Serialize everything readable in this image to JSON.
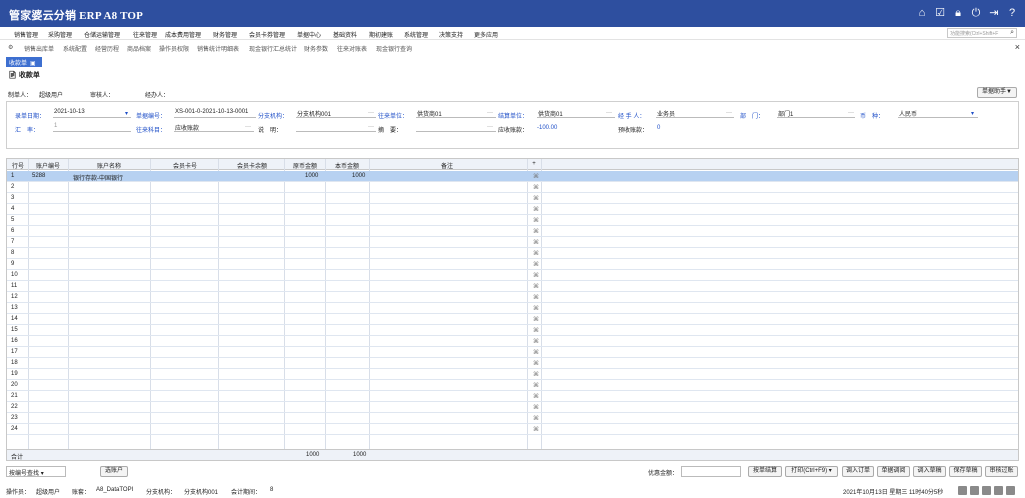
{
  "app": {
    "title": "管家婆云分销 ERP A8 TOP"
  },
  "menu": [
    "销售管理",
    "采购管理",
    "仓储运输管理",
    "往来管理",
    "成本费用管理",
    "财务管理",
    "会员卡券管理",
    "单据中心",
    "基础资料",
    "期初建账",
    "系统管理",
    "决策支持",
    "更多应用"
  ],
  "func_search": "功能搜索(Ctrl+Shift+F",
  "quick": [
    "销售出库单",
    "系统配置",
    "经营历程",
    "商品档案",
    "操作员权限",
    "销售统计明细表",
    "现金银行汇总统计",
    "财务参数",
    "往来对账表",
    "现金银行查询"
  ],
  "tab": "收款单",
  "doc": {
    "title": "收款单",
    "maker_label": "制单人：",
    "maker": "超级用户",
    "reviewer_label": "审核人：",
    "handler_label": "经办人：",
    "helper": "单据助手▼"
  },
  "fields": {
    "date_label": "录单日期：",
    "date": "2021-10-13",
    "no_label": "单据编号：",
    "no": "XS-001-0-2021-10-13-0001",
    "branch_label": "分支机构：",
    "branch": "分支机构001",
    "unit_label": "往来单位：",
    "unit": "供货商01",
    "settle_label": "结算单位：",
    "settle": "供货商01",
    "agent_label": "经 手 人：",
    "agent": "业务员",
    "dept_label": "部　门：",
    "dept": "部门1",
    "cur_label": "币　种：",
    "cur": "人民币",
    "rate_label": "汇　率：",
    "rate": "1",
    "subject_label": "往来科目：",
    "subject": "应收账款",
    "note_label": "说　明：",
    "summary_label": "摘　要：",
    "recv_label": "应收账款：",
    "recv": "-100.00",
    "adv_label": "预收账款：",
    "adv": "0"
  },
  "grid": {
    "headers": [
      "行号",
      "账户编号",
      "账户名称",
      "会员卡号",
      "会员卡余额",
      "原币金额",
      "本币金额",
      "备注"
    ],
    "row1": {
      "no": "1",
      "code": "5288",
      "name": "银行存款-中国银行",
      "orig": "1000",
      "local": "1000"
    },
    "rows": [
      "2",
      "3",
      "4",
      "5",
      "6",
      "7",
      "8",
      "9",
      "10",
      "11",
      "12",
      "13",
      "14",
      "15",
      "16",
      "17",
      "18",
      "19",
      "20",
      "21",
      "22",
      "23",
      "24"
    ],
    "total_label": "合计",
    "total_orig": "1000",
    "total_local": "1000"
  },
  "bottom": {
    "search": "按编号查找",
    "select": "选账户",
    "discount_label": "优惠金额：",
    "buttons": [
      "按单结算",
      "打印(Ctrl+F9)",
      "调入订单",
      "单据调阅",
      "调入草稿",
      "保存草稿",
      "审核过账"
    ]
  },
  "status": {
    "op_label": "操作员：",
    "op": "超级用户",
    "acct_label": "账套：",
    "acct": "A8_DataTOPI",
    "branch_label": "分支机构：",
    "branch": "分支机构001",
    "period_label": "会计期间：",
    "period": "8",
    "datetime": "2021年10月13日 星期三 11时40分5秒"
  }
}
